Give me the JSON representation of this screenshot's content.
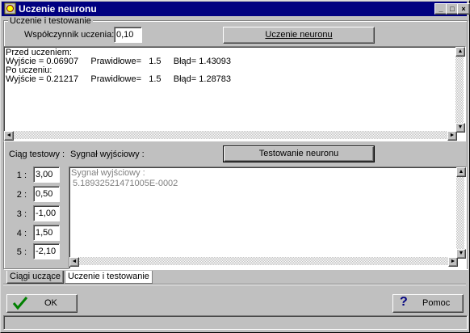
{
  "window": {
    "title": "Uczenie neuronu"
  },
  "group": {
    "label": "Uczenie i testowanie"
  },
  "learning_rate": {
    "label": "Współczynnik uczenia:",
    "value": "0,10"
  },
  "train_button": {
    "label": "Uczenie neuronu"
  },
  "train_log": {
    "text": "Przed uczeniem:\nWyjście = 0.06907     Prawidłowe=   1.5     Błąd= 1.43093\nPo uczeniu:\nWyjście = 0.21217     Prawidłowe=   1.5     Błąd= 1.28783"
  },
  "test_section": {
    "sequence_label": "Ciąg testowy :",
    "signal_label": "Sygnał wyjściowy :",
    "test_button": "Testowanie neuronu",
    "indices": [
      "1 :",
      "2 :",
      "3 :",
      "4 :",
      "5 :"
    ],
    "values": [
      "3,00",
      "0,50",
      "-1,00",
      "1,50",
      "-2,10"
    ],
    "output_title": "Sygnał wyjściowy :",
    "output_value": "5.18932521471005E-0002"
  },
  "tabs": [
    {
      "label": "Ciągi uczące"
    },
    {
      "label": "Uczenie i testowanie"
    }
  ],
  "footer": {
    "ok_label": "OK",
    "help_label": "Pomoc"
  },
  "colors": {
    "titlebar": "#000080",
    "face": "#c0c0c0",
    "ok_check": "#008000",
    "help_icon": "#000080"
  }
}
